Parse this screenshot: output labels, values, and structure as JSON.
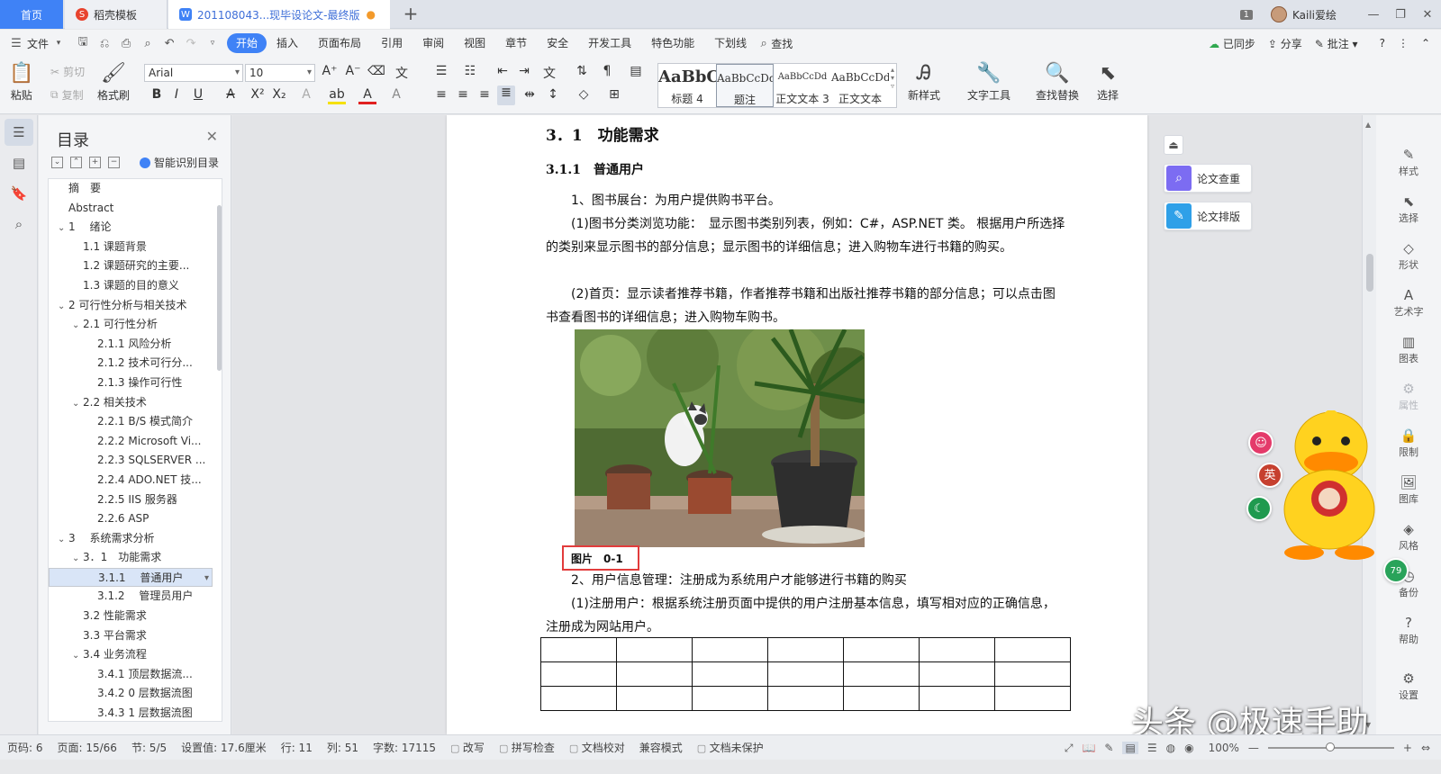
{
  "titlebar": {
    "tabs": [
      {
        "label": "首页"
      },
      {
        "label": "稻壳模板"
      },
      {
        "label": "201108043...现毕设论文-最终版"
      }
    ],
    "page_badge": "1",
    "user_name": "Kaili爱绘"
  },
  "menubar": {
    "file_label": "文件",
    "tabs": [
      "开始",
      "插入",
      "页面布局",
      "引用",
      "审阅",
      "视图",
      "章节",
      "安全",
      "开发工具",
      "特色功能",
      "下划线"
    ],
    "find_label": "查找",
    "sync_label": "已同步",
    "share_label": "分享",
    "comment_label": "批注"
  },
  "ribbon": {
    "paste": "粘贴",
    "cut": "剪切",
    "copy": "复制",
    "format_painter": "格式刷",
    "font_name": "Arial",
    "font_size": "10",
    "styles": [
      {
        "preview": "AaBbC",
        "name": "标题 4"
      },
      {
        "preview": "AaBbCcDd",
        "name": "题注"
      },
      {
        "preview": "AaBbCcDd",
        "name": "正文文本 3"
      },
      {
        "preview": "AaBbCcDd",
        "name": "正文文本"
      }
    ],
    "new_style": "新样式",
    "text_tools": "文字工具",
    "find_replace": "查找替换",
    "select": "选择"
  },
  "toc": {
    "title": "目录",
    "smart_label": "智能识别目录",
    "items": [
      {
        "level": 0,
        "caret": "",
        "text": "摘　要"
      },
      {
        "level": 0,
        "caret": "",
        "text": "Abstract"
      },
      {
        "level": 0,
        "caret": "v",
        "text": "1　 绪论"
      },
      {
        "level": 1,
        "caret": "",
        "text": "1.1 课题背景"
      },
      {
        "level": 1,
        "caret": "",
        "text": "1.2 课题研究的主要..."
      },
      {
        "level": 1,
        "caret": "",
        "text": "1.3 课题的目的意义"
      },
      {
        "level": 0,
        "caret": "v",
        "text": "2 可行性分析与相关技术"
      },
      {
        "level": 1,
        "caret": "v",
        "text": "2.1 可行性分析"
      },
      {
        "level": 2,
        "caret": "",
        "text": "2.1.1 风险分析"
      },
      {
        "level": 2,
        "caret": "",
        "text": "2.1.2 技术可行分..."
      },
      {
        "level": 2,
        "caret": "",
        "text": "2.1.3 操作可行性"
      },
      {
        "level": 1,
        "caret": "v",
        "text": "2.2 相关技术"
      },
      {
        "level": 2,
        "caret": "",
        "text": "2.2.1 B/S 模式简介"
      },
      {
        "level": 2,
        "caret": "",
        "text": "2.2.2 Microsoft Vi..."
      },
      {
        "level": 2,
        "caret": "",
        "text": "2.2.3 SQLSERVER ..."
      },
      {
        "level": 2,
        "caret": "",
        "text": "2.2.4 ADO.NET 技..."
      },
      {
        "level": 2,
        "caret": "",
        "text": "2.2.5 IIS 服务器"
      },
      {
        "level": 2,
        "caret": "",
        "text": "2.2.6 ASP"
      },
      {
        "level": 0,
        "caret": "v",
        "text": "3　 系统需求分析"
      },
      {
        "level": 1,
        "caret": "v",
        "text": "3．1　功能需求"
      },
      {
        "level": 2,
        "caret": "",
        "text": "3.1.1　 普通用户",
        "selected": true
      },
      {
        "level": 2,
        "caret": "",
        "text": "3.1.2　 管理员用户"
      },
      {
        "level": 1,
        "caret": "",
        "text": "3.2 性能需求"
      },
      {
        "level": 1,
        "caret": "",
        "text": "3.3 平台需求"
      },
      {
        "level": 1,
        "caret": "v",
        "text": "3.4 业务流程"
      },
      {
        "level": 2,
        "caret": "",
        "text": "3.4.1 顶层数据流..."
      },
      {
        "level": 2,
        "caret": "",
        "text": "3.4.2 0 层数据流图"
      },
      {
        "level": 2,
        "caret": "",
        "text": "3.4.3 1 层数据流图"
      }
    ]
  },
  "document": {
    "heading2": "3．1　功能需求",
    "heading3": "3.1.1　普通用户",
    "p1": "1、图书展台：为用户提供购书平台。",
    "p2": "(1)图书分类浏览功能：　显示图书类别列表，例如：C#，ASP.NET 类。 根据用户所选择的类别来显示图书的部分信息；显示图书的详细信息；进入购物车进行书籍的购买。",
    "p3": "(2)首页：显示读者推荐书籍，作者推荐书籍和出版社推荐书籍的部分信息；可以点击图书查看图书的详细信息；进入购物车购书。",
    "caption": "图片　0-1",
    "p4": "2、用户信息管理：注册成为系统用户才能够进行书籍的购买",
    "p5": "(1)注册用户：根据系统注册页面中提供的用户注册基本信息，填写相对应的正确信息，注册成为网站用户。",
    "table_rows": 3,
    "table_cols": 7
  },
  "paper_tools": {
    "check": "论文查重",
    "layout": "论文排版"
  },
  "rightbar": [
    "样式",
    "选择",
    "形状",
    "艺术字",
    "图表",
    "属性",
    "限制",
    "图库",
    "风格",
    "备份",
    "帮助",
    "设置"
  ],
  "float_bubbles": {
    "en": "英",
    "badge": "79"
  },
  "watermark": "头条 @极速手助",
  "statusbar": {
    "page_code": "页码: 6",
    "page": "页面: 15/66",
    "section": "节: 5/5",
    "setting": "设置值: 17.6厘米",
    "row": "行: 11",
    "col": "列: 51",
    "words": "字数: 17115",
    "revise": "改写",
    "spell": "拼写检查",
    "proof": "文档校对",
    "compat": "兼容模式",
    "protect": "文档未保护",
    "zoom": "100%"
  },
  "colors": {
    "accent": "#3f82f6",
    "caption_highlight": "#e23c3c"
  }
}
